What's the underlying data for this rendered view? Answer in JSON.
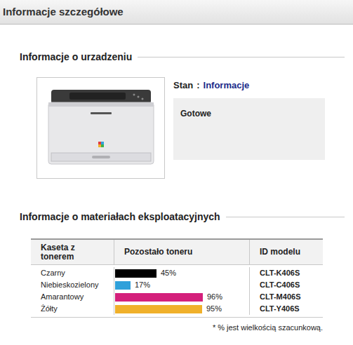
{
  "header": {
    "title": "Informacje szczegółowe"
  },
  "device": {
    "title": "Informacje o urzadzeniu",
    "status_label": "Stan",
    "separator": ":",
    "status_link": "Informacje",
    "message": "Gotowe"
  },
  "supplies": {
    "title": "Informacje o materiałach eksploatacyjnych",
    "columns": [
      "Kaseta z tonerem",
      "Pozostało toneru",
      "ID modelu"
    ],
    "rows": [
      {
        "name": "Czarny",
        "level": 0.45,
        "reading": "45%",
        "model": "CLT-K406S",
        "color": "#000000"
      },
      {
        "name": "Niebieskozielony",
        "level": 0.17,
        "reading": "17%",
        "model": "CLT-C406S",
        "color": "#2fa0da"
      },
      {
        "name": "Amarantowy",
        "level": 0.96,
        "reading": "96%",
        "model": "CLT-M406S",
        "color": "#d4207b"
      },
      {
        "name": "Żółty",
        "level": 0.95,
        "reading": "95%",
        "model": "CLT-Y406S",
        "color": "#f0b02a"
      }
    ],
    "footnote": "* % jest wielkością szacunkową."
  }
}
